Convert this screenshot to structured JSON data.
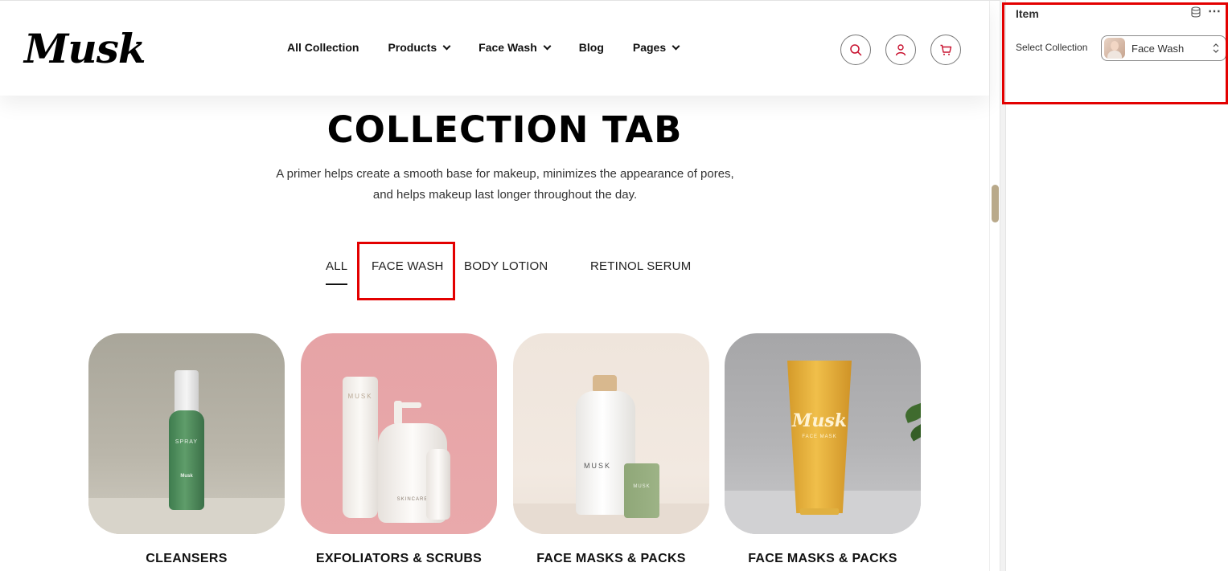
{
  "header": {
    "logo": "Musk",
    "nav": [
      {
        "label": "All Collection",
        "has_dropdown": false
      },
      {
        "label": "Products",
        "has_dropdown": true
      },
      {
        "label": "Face Wash",
        "has_dropdown": true
      },
      {
        "label": "Blog",
        "has_dropdown": false
      },
      {
        "label": "Pages",
        "has_dropdown": true
      }
    ],
    "icons": [
      "search-icon",
      "account-icon",
      "cart-icon"
    ]
  },
  "hero": {
    "title": "COLLECTION TAB",
    "description": "A primer helps create a smooth base for makeup, minimizes the appearance of pores, and helps makeup last longer throughout the day."
  },
  "tabs": [
    {
      "label": "ALL",
      "active": true
    },
    {
      "label": "FACE WASH",
      "active": false,
      "highlighted": true
    },
    {
      "label": "BODY LOTION",
      "active": false
    },
    {
      "label": "RETINOL SERUM",
      "active": false
    }
  ],
  "cards": [
    {
      "title": "CLEANSERS",
      "product_text": "SPRAY",
      "brand": "Musk"
    },
    {
      "title": "EXFOLIATORS & SCRUBS",
      "product_text": "MUSK",
      "brand": "SKINCARE"
    },
    {
      "title": "FACE MASKS & PACKS",
      "product_text": "MUSK",
      "brand": "MUSK"
    },
    {
      "title": "FACE MASKS & PACKS",
      "product_text": "Musk",
      "brand": "FACE MASK"
    }
  ],
  "panel": {
    "title": "Item",
    "field_label": "Select Collection",
    "field_value": "Face Wash"
  },
  "colors": {
    "highlight": "#e30000",
    "accent_icon": "#c8102e",
    "scroll_thumb": "#b9a98a"
  }
}
